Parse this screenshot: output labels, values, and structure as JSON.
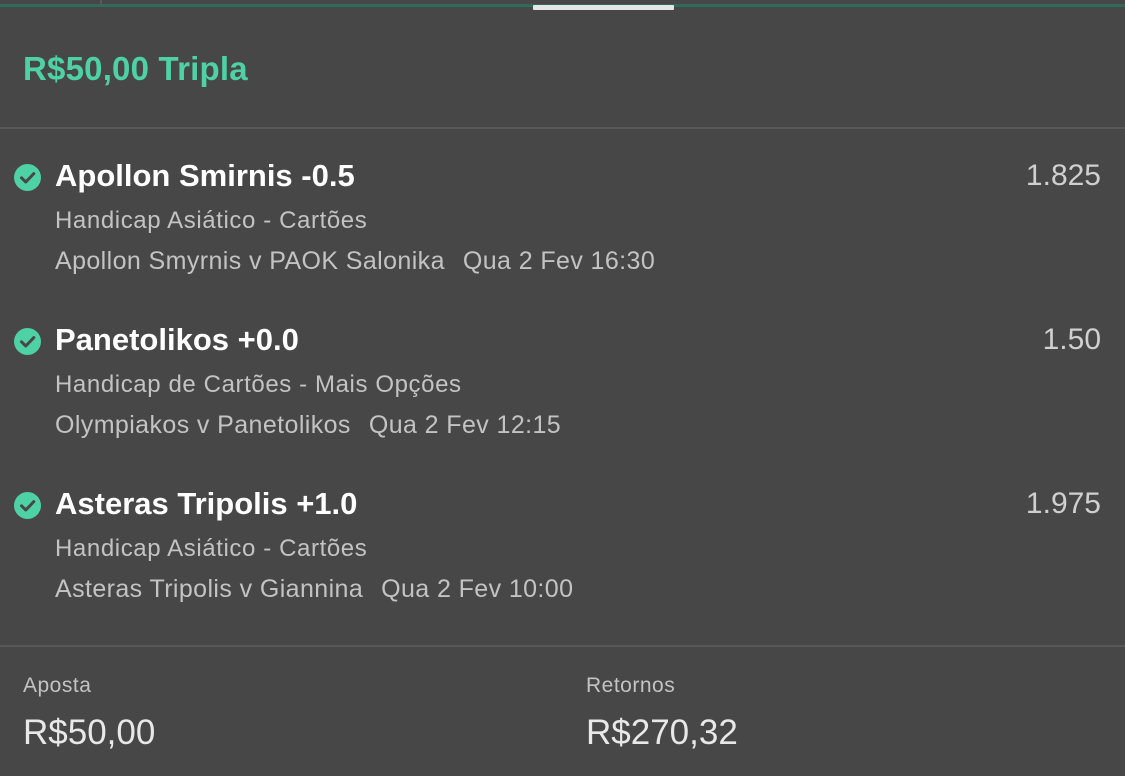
{
  "header": {
    "title": "R$50,00 Tripla"
  },
  "colors": {
    "accent": "#4fd1a6",
    "background": "#474747",
    "divider": "#575757",
    "muted_text": "#c3c3c3"
  },
  "selections": [
    {
      "status_icon": "check-circle-icon",
      "name": "Apollon Smirnis -0.5",
      "odds": "1.825",
      "market": "Handicap Asiático - Cartões",
      "event": "Apollon Smyrnis v PAOK Salonika",
      "time": "Qua 2 Fev 16:30"
    },
    {
      "status_icon": "check-circle-icon",
      "name": "Panetolikos +0.0",
      "odds": "1.50",
      "market": "Handicap de Cartões - Mais Opções",
      "event": "Olympiakos v Panetolikos",
      "time": "Qua 2 Fev 12:15"
    },
    {
      "status_icon": "check-circle-icon",
      "name": "Asteras Tripolis +1.0",
      "odds": "1.975",
      "market": "Handicap Asiático - Cartões",
      "event": "Asteras Tripolis v Giannina",
      "time": "Qua 2 Fev 10:00"
    }
  ],
  "footer": {
    "stake_label": "Aposta",
    "stake_value": "R$50,00",
    "returns_label": "Retornos",
    "returns_value": "R$270,32"
  }
}
